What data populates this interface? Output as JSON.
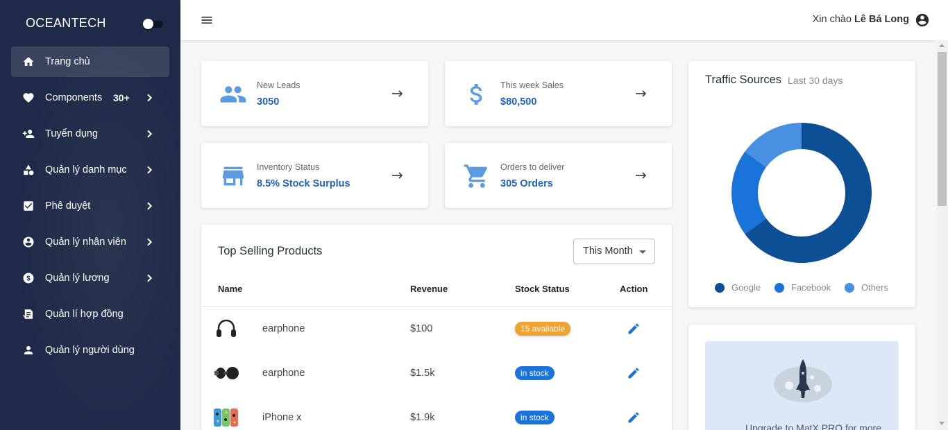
{
  "sidebar": {
    "brand": "OCEANTECH",
    "items": [
      {
        "label": "Trang chủ",
        "icon": "home-icon",
        "active": true
      },
      {
        "label": "Components",
        "icon": "heart-icon",
        "badge": "30+",
        "chevron": true
      },
      {
        "label": "Tuyển dụng",
        "icon": "person-add-icon",
        "chevron": true
      },
      {
        "label": "Quản lý danh mục",
        "icon": "category-icon",
        "chevron": true
      },
      {
        "label": "Phê duyệt",
        "icon": "checkbox-icon",
        "chevron": true
      },
      {
        "label": "Quản lý nhân viên",
        "icon": "account-circle-icon",
        "chevron": true
      },
      {
        "label": "Quản lý lương",
        "icon": "dollar-circle-icon",
        "chevron": true
      },
      {
        "label": "Quản lí hợp đồng",
        "icon": "contract-icon"
      },
      {
        "label": "Quản lý người dùng",
        "icon": "person-icon"
      }
    ]
  },
  "topbar": {
    "greeting": "Xin chào",
    "user_name": "Lê Bá Long"
  },
  "stats": [
    {
      "title": "New Leads",
      "value": "3050",
      "icon": "people-icon"
    },
    {
      "title": "This week Sales",
      "value": "$80,500",
      "icon": "dollar-icon"
    },
    {
      "title": "Inventory Status",
      "value": "8.5% Stock Surplus",
      "icon": "store-icon"
    },
    {
      "title": "Orders to deliver",
      "value": "305 Orders",
      "icon": "cart-icon"
    }
  ],
  "top_selling": {
    "title": "Top Selling Products",
    "period": "This Month",
    "columns": [
      "Name",
      "Revenue",
      "Stock Status",
      "Action"
    ],
    "rows": [
      {
        "name": "earphone",
        "revenue": "$100",
        "status": "15 available",
        "status_type": "warning",
        "thumb": "headphones-icon"
      },
      {
        "name": "earphone",
        "revenue": "$1.5k",
        "status": "in stock",
        "status_type": "ok",
        "thumb": "earbuds-icon"
      },
      {
        "name": "iPhone x",
        "revenue": "$1.9k",
        "status": "in stock",
        "status_type": "ok",
        "thumb": "phone-cases-icon"
      }
    ]
  },
  "traffic": {
    "title": "Traffic Sources",
    "subtitle": "Last 30 days",
    "colors": {
      "Google": "#0d4f94",
      "Facebook": "#1a73d8",
      "Others": "#4a90e2"
    }
  },
  "chart_data": {
    "type": "pie",
    "categories": [
      "Google",
      "Facebook",
      "Others"
    ],
    "values": [
      65,
      20,
      15
    ],
    "legend": "bottom"
  },
  "promo": {
    "text": "Upgrade to MatX PRO for more"
  }
}
